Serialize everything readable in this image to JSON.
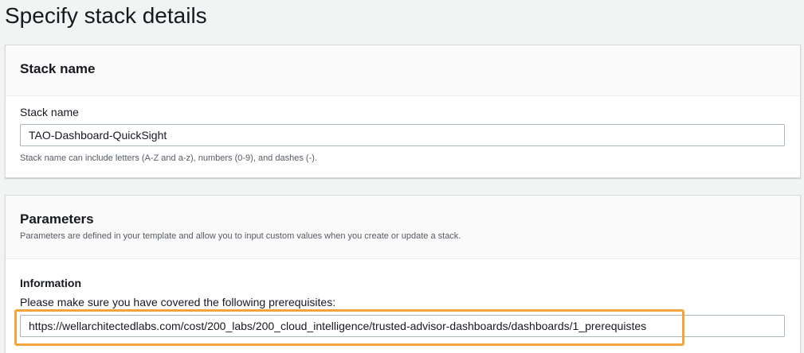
{
  "page": {
    "title": "Specify stack details"
  },
  "stack_name_panel": {
    "heading": "Stack name",
    "field_label": "Stack name",
    "field_value": "TAO-Dashboard-QuickSight",
    "hint": "Stack name can include letters (A-Z and a-z), numbers (0-9), and dashes (-)."
  },
  "parameters_panel": {
    "heading": "Parameters",
    "description": "Parameters are defined in your template and allow you to input custom values when you create or update a stack.",
    "information": {
      "label": "Information",
      "description": "Please make sure you have covered the following prerequisites:",
      "value": "https://wellarchitectedlabs.com/cost/200_labs/200_cloud_intelligence/trusted-advisor-dashboards/dashboards/1_prerequistes"
    }
  },
  "colors": {
    "highlight": "#f7a33b",
    "background": "#f2f3f3",
    "panel_header": "#fafafa"
  }
}
